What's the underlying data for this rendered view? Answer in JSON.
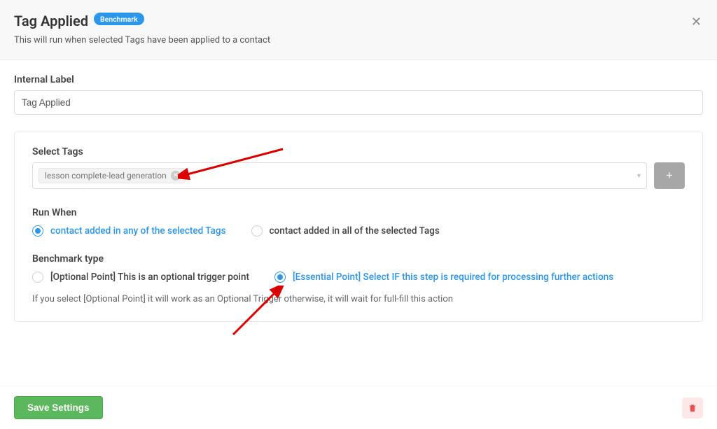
{
  "header": {
    "title": "Tag Applied",
    "badge": "Benchmark",
    "description": "This will run when selected Tags have been applied to a contact"
  },
  "internal_label": {
    "label": "Internal Label",
    "value": "Tag Applied"
  },
  "select_tags": {
    "label": "Select Tags",
    "chip": "lesson complete-lead generation"
  },
  "run_when": {
    "label": "Run When",
    "option_any": "contact added in any of the selected Tags",
    "option_all": "contact added in all of the selected Tags"
  },
  "benchmark_type": {
    "label": "Benchmark type",
    "option_optional": "[Optional Point] This is an optional trigger point",
    "option_essential": "[Essential Point] Select IF this step is required for processing further actions",
    "hint": "If you select [Optional Point] it will work as an Optional Trigger otherwise, it will wait for full-fill this action"
  },
  "footer": {
    "save": "Save Settings"
  }
}
